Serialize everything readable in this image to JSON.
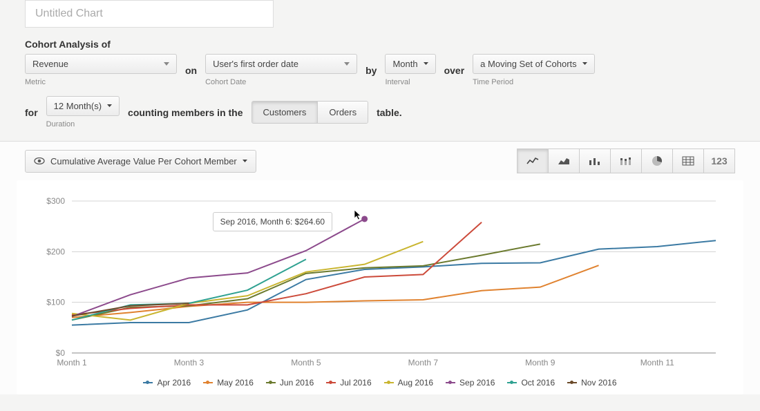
{
  "title_placeholder": "Untitled Chart",
  "cohort_label": "Cohort Analysis of",
  "metric": {
    "value": "Revenue",
    "sublabel": "Metric"
  },
  "on_word": "on",
  "cohort_date": {
    "value": "User's first order date",
    "sublabel": "Cohort Date"
  },
  "by_word": "by",
  "interval": {
    "value": "Month",
    "sublabel": "Interval"
  },
  "over_word": "over",
  "time_period": {
    "value": "a Moving Set of Cohorts",
    "sublabel": "Time Period"
  },
  "for_word": "for",
  "duration": {
    "value": "12 Month(s)",
    "sublabel": "Duration"
  },
  "counting_label": "counting members in the",
  "table_options": {
    "a": "Customers",
    "b": "Orders"
  },
  "table_word": "table.",
  "chart_dd": "Cumulative Average Value Per Cohort Member",
  "icon_text": "123",
  "tooltip": "Sep 2016, Month 6: $264.60",
  "chart_data": {
    "type": "line",
    "title": "",
    "xlabel": "",
    "ylabel": "",
    "ylim": [
      0,
      300
    ],
    "x_ticks": [
      "Month 1",
      "Month 3",
      "Month 5",
      "Month 7",
      "Month 9",
      "Month 11"
    ],
    "y_ticks": [
      0,
      100,
      200,
      300
    ],
    "categories": [
      "Month 1",
      "Month 2",
      "Month 3",
      "Month 4",
      "Month 5",
      "Month 6",
      "Month 7",
      "Month 8",
      "Month 9",
      "Month 10",
      "Month 11",
      "Month 12"
    ],
    "series": [
      {
        "name": "Apr 2016",
        "color": "#3b7aa3",
        "values": [
          55,
          60,
          60,
          85,
          145,
          165,
          170,
          177,
          178,
          205,
          210,
          222
        ]
      },
      {
        "name": "May 2016",
        "color": "#e0822f",
        "values": [
          70,
          80,
          92,
          100,
          100,
          103,
          105,
          123,
          130,
          173
        ]
      },
      {
        "name": "Jun 2016",
        "color": "#6b7a2e",
        "values": [
          65,
          90,
          93,
          107,
          157,
          168,
          172,
          193,
          215
        ]
      },
      {
        "name": "Jul 2016",
        "color": "#cc4a3a",
        "values": [
          75,
          88,
          95,
          95,
          117,
          150,
          155,
          258
        ]
      },
      {
        "name": "Aug 2016",
        "color": "#c9b52f",
        "values": [
          78,
          65,
          98,
          113,
          160,
          175,
          220
        ]
      },
      {
        "name": "Sep 2016",
        "color": "#8c4a8c",
        "values": [
          72,
          115,
          148,
          158,
          202,
          264.6
        ]
      },
      {
        "name": "Oct 2016",
        "color": "#2fa191",
        "values": [
          65,
          95,
          98,
          124,
          185
        ]
      },
      {
        "name": "Nov 2016",
        "color": "#6b4a2a",
        "values": [
          73,
          93,
          98
        ]
      }
    ],
    "tooltip_point": {
      "series": "Sep 2016",
      "x_index": 5,
      "value": 264.6
    }
  }
}
